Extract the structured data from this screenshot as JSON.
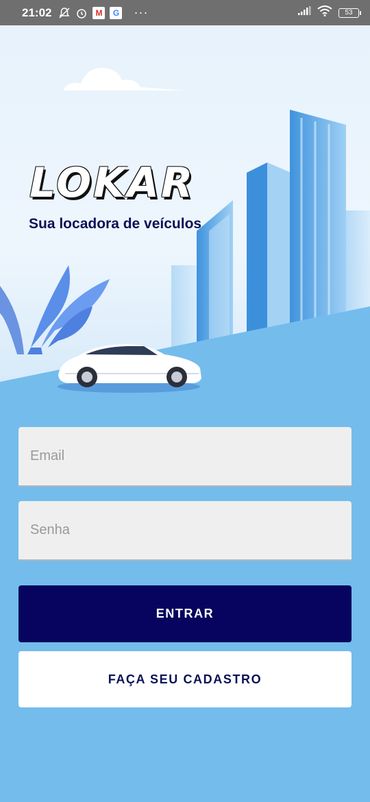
{
  "status_bar": {
    "time": "21:02",
    "battery": "53",
    "left_icons": [
      "silent-icon",
      "alarm-icon",
      "gmail-icon",
      "google-icon"
    ],
    "gmail_letter": "M",
    "google_letter": "G",
    "more": "···",
    "right_icons": [
      "signal-icon",
      "wifi-icon",
      "battery-icon"
    ]
  },
  "hero": {
    "brand": "LOKAR",
    "tagline": "Sua locadora de veículos",
    "illustration": [
      "cloud-icon",
      "buildings-icon",
      "plant-icon",
      "car-icon"
    ]
  },
  "form": {
    "email_placeholder": "Email",
    "password_placeholder": "Senha",
    "login_label": "ENTRAR",
    "signup_label": "FAÇA SEU CADASTRO"
  },
  "colors": {
    "background": "#74bcec",
    "primary_button": "#06045e",
    "tagline": "#0a1157",
    "status_bar": "#6f6f6f"
  }
}
